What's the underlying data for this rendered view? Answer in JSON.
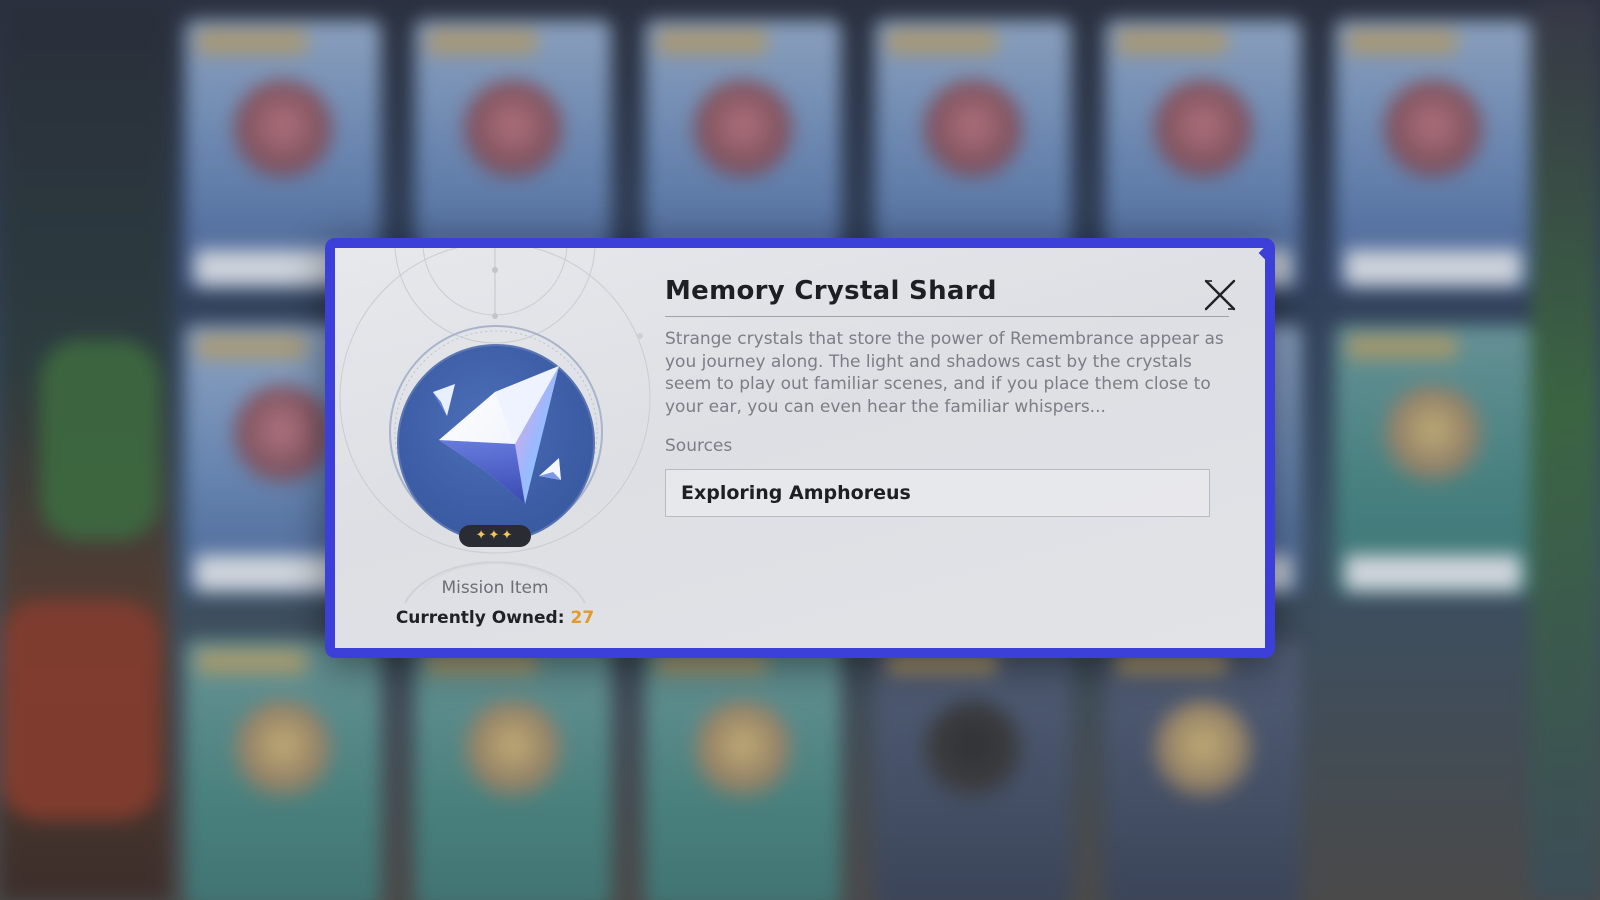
{
  "item": {
    "name": "Memory Crystal Shard",
    "description": "Strange crystals that store the power of Remembrance appear as you journey along. The light and shadows cast by the crystals seem to play out familiar scenes, and if you place them close to your ear, you can even hear the familiar whispers...",
    "type": "Mission Item",
    "rarity_stars": 3,
    "rarity_glyph": "✦✦✦",
    "owned_label": "Currently Owned:",
    "owned_count": "27",
    "icon": "crystal-shard-icon"
  },
  "sources": {
    "label": "Sources",
    "items": [
      "Exploring Amphoreus"
    ]
  },
  "controls": {
    "close_icon": "close-icon"
  },
  "colors": {
    "dialog_border": "#3c3fd8",
    "dialog_background": "#e2e3e7",
    "icon_background": "#3d5ea6",
    "owned_count": "#e39a2a",
    "rarity_star": "#f3c45a"
  }
}
